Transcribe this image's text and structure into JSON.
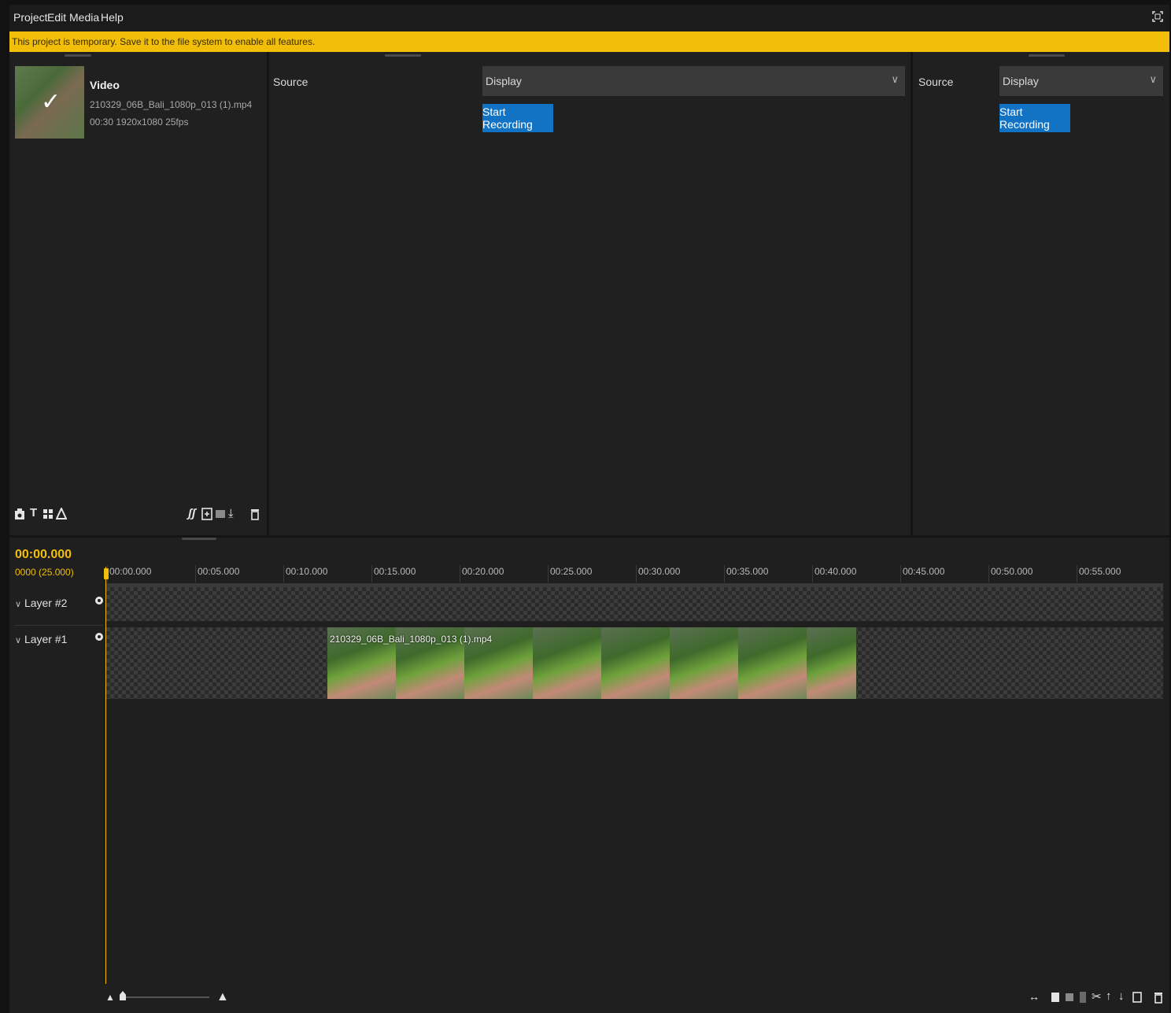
{
  "menubar": {
    "items": [
      "Project",
      "Edit",
      "Media",
      "Help"
    ]
  },
  "banner": {
    "text": "This project is temporary. Save it to the file system to enable all features."
  },
  "media": {
    "item": {
      "title": "Video",
      "filename": "210329_06B_Bali_1080p_013 (1).mp4",
      "meta": "00:30 1920x1080 25fps"
    }
  },
  "recorder_left": {
    "source_label": "Source",
    "display_value": "Display",
    "start_label": "Start Recording"
  },
  "recorder_right": {
    "source_label": "Source",
    "display_value": "Display",
    "start_label": "Start Recording"
  },
  "timeline": {
    "timecode": "00:00.000",
    "frame_info": "0000 (25.000)",
    "ruler": [
      "00:00.000",
      "00:05.000",
      "00:10.000",
      "00:15.000",
      "00:20.000",
      "00:25.000",
      "00:30.000",
      "00:35.000",
      "00:40.000",
      "00:45.000",
      "00:50.000",
      "00:55.000"
    ],
    "layers": [
      {
        "name": "Layer #2"
      },
      {
        "name": "Layer #1"
      }
    ],
    "clip": {
      "name": "210329_06B_Bali_1080p_013 (1).mp4",
      "start_seconds": 12.5,
      "duration_seconds": 30
    }
  },
  "colors": {
    "accent": "#f1bf0a",
    "primary_button": "#1273c4",
    "background": "#1f1f1f"
  }
}
